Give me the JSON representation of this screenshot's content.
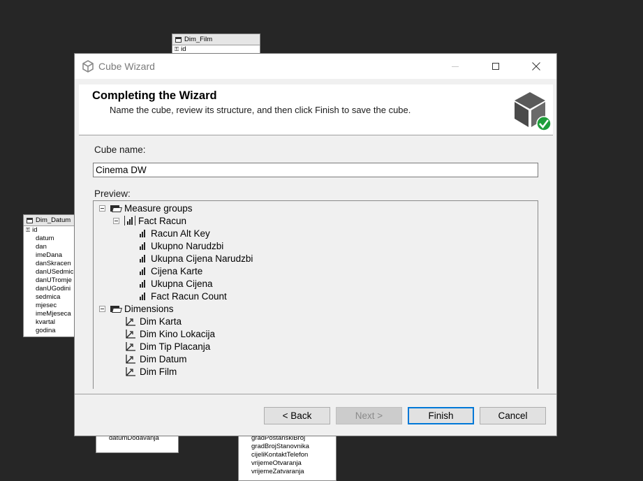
{
  "background_tables": {
    "dim_film": {
      "title": "Dim_Film",
      "rows": [
        "id"
      ]
    },
    "dim_datum": {
      "title": "Dim_Datum",
      "pk": "id",
      "rows": [
        "datum",
        "dan",
        "imeDana",
        "danSkracen",
        "danUSedmic",
        "danUTromje",
        "danUGodini",
        "sedmica",
        "mjesec",
        "imeMjeseca",
        "kvartal",
        "godina"
      ]
    },
    "bottom_left": {
      "rows": [
        "datumDodavanja"
      ]
    },
    "bottom_right": {
      "rows": [
        "gradPostanskiBroj",
        "gradBrojStanovnika",
        "cijeliKontaktTelefon",
        "vrijemeOtvaranja",
        "vrijemeZatvaranja"
      ]
    }
  },
  "dialog": {
    "title": "Cube Wizard",
    "header_title": "Completing the Wizard",
    "header_subtitle": "Name the cube, review its structure, and then click Finish to save the cube.",
    "cube_name_label": "Cube name:",
    "cube_name_value": "Cinema DW",
    "preview_label": "Preview:",
    "tree": {
      "measure_groups_label": "Measure groups",
      "fact_label": "Fact Racun",
      "measures": [
        "Racun Alt Key",
        "Ukupno Narudzbi",
        "Ukupna Cijena Narudzbi",
        "Cijena Karte",
        "Ukupna Cijena",
        "Fact Racun Count"
      ],
      "dimensions_label": "Dimensions",
      "dimensions": [
        "Dim Karta",
        "Dim Kino Lokacija",
        "Dim Tip Placanja",
        "Dim Datum",
        "Dim Film"
      ]
    },
    "buttons": {
      "back": "< Back",
      "next": "Next >",
      "finish": "Finish",
      "cancel": "Cancel"
    },
    "colors": {
      "accent": "#0078d7",
      "check": "#1e9e3a"
    }
  }
}
